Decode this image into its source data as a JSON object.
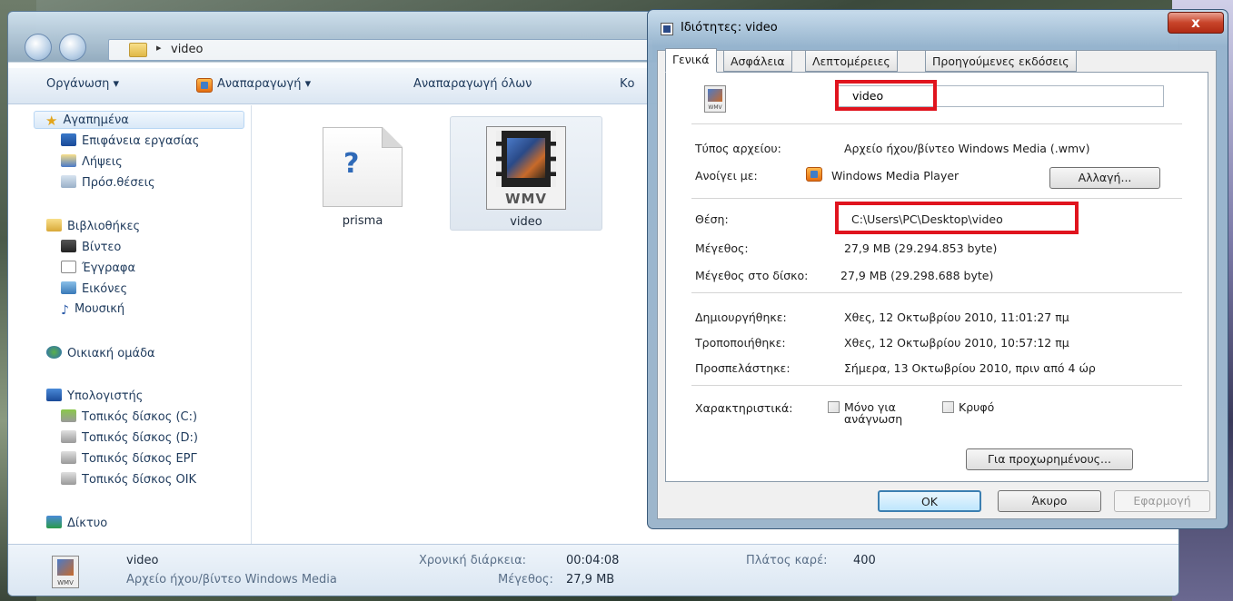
{
  "explorer": {
    "address": {
      "crumb": "video"
    },
    "toolbar": {
      "organize": "Οργάνωση ▾",
      "play": "Αναπαραγωγή ▾",
      "play_all": "Αναπαραγωγή όλων",
      "burn_partial": "Κο"
    },
    "sidebar": {
      "favorites": {
        "label": "Αγαπημένα",
        "items": [
          "Επιφάνεια εργασίας",
          "Λήψεις",
          "Πρόσ.θέσεις"
        ]
      },
      "libraries": {
        "label": "Βιβλιοθήκες",
        "items": [
          "Βίντεο",
          "Έγγραφα",
          "Εικόνες",
          "Μουσική"
        ]
      },
      "homegroup": "Οικιακή ομάδα",
      "computer": {
        "label": "Υπολογιστής",
        "items": [
          "Τοπικός δίσκος (C:)",
          "Τοπικός δίσκος (D:)",
          "Τοπικός  δίσκος ΕΡΓ",
          "Τοπικός δίσκος ΟΙΚ"
        ]
      },
      "network": "Δίκτυο"
    },
    "files": [
      {
        "name": "prisma",
        "icon": "unknown-file-icon"
      },
      {
        "name": "video",
        "icon": "wmv-file-icon",
        "badge": "WMV"
      }
    ],
    "status": {
      "name": "video",
      "type": "Αρχείο ήχου/βίντεο Windows Media",
      "duration_label": "Χρονική διάρκεια:",
      "duration_value": "00:04:08",
      "size_label": "Μέγεθος:",
      "size_value": "27,9 MB",
      "frame_width_label": "Πλάτος καρέ:",
      "frame_width_value": "400"
    }
  },
  "dialog": {
    "title": "Ιδιότητες: video",
    "close": "x",
    "tabs": [
      "Γενικά",
      "Ασφάλεια",
      "Λεπτομέρειες",
      "Προηγούμενες εκδόσεις"
    ],
    "icon_badge": "WMV",
    "filename": "video",
    "file_type_label": "Τύπος αρχείου:",
    "file_type_value": "Αρχείο ήχου/βίντεο Windows Media (.wmv)",
    "opens_with_label": "Ανοίγει με:",
    "opens_with_value": "Windows Media Player",
    "change_button": "Αλλαγή...",
    "location_label": "Θέση:",
    "location_value": "C:\\Users\\PC\\Desktop\\video",
    "size_label": "Μέγεθος:",
    "size_value": "27,9 MB (29.294.853 byte)",
    "size_on_disk_label": "Μέγεθος στο δίσκο:",
    "size_on_disk_value": "27,9 MB (29.298.688 byte)",
    "created_label": "Δημιουργήθηκε:",
    "created_value": "Χθες, 12 Οκτωβρίου 2010, 11:01:27 πμ",
    "modified_label": "Τροποποιήθηκε:",
    "modified_value": "Χθες, 12 Οκτωβρίου 2010, 10:57:12 πμ",
    "accessed_label": "Προσπελάστηκε:",
    "accessed_value": "Σήμερα, 13 Οκτωβρίου 2010, πριν από 4 ώρ",
    "attributes_label": "Χαρακτηριστικά:",
    "readonly_label_1": "Μόνο για",
    "readonly_label_2": "ανάγνωση",
    "hidden_label": "Κρυφό",
    "advanced_button": "Για προχωρημένους...",
    "ok_button": "OK",
    "cancel_button": "Άκυρο",
    "apply_button": "Εφαρμογή",
    "highlight_color": "#e0141e"
  }
}
